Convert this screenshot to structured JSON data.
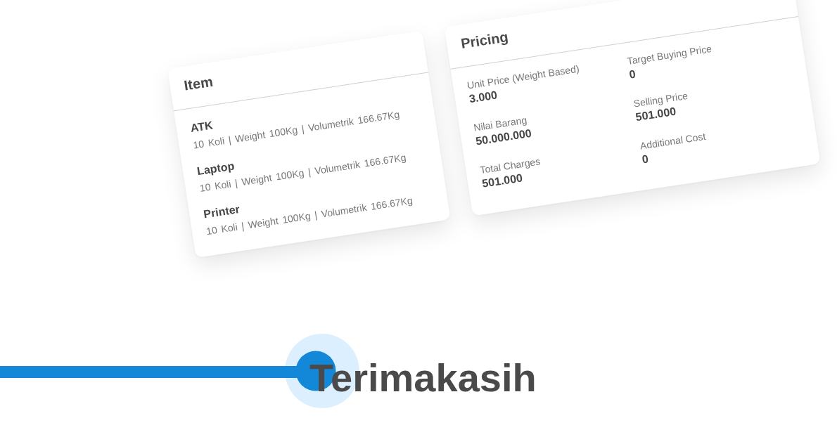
{
  "item_card": {
    "title": "Item",
    "items": [
      {
        "name": "ATK",
        "details": "10 Koli | Weight 100Kg | Volumetrik 166.67Kg"
      },
      {
        "name": "Laptop",
        "details": "10 Koli | Weight 100Kg | Volumetrik 166.67Kg"
      },
      {
        "name": "Printer",
        "details": "10 Koli | Weight 100Kg | Volumetrik 166.67Kg"
      }
    ]
  },
  "pricing_card": {
    "title": "Pricing",
    "fields": [
      {
        "label": "Unit Price (Weight Based)",
        "value": "3.000"
      },
      {
        "label": "Target Buying Price",
        "value": "0"
      },
      {
        "label": "Nilai Barang",
        "value": "50.000.000"
      },
      {
        "label": "Selling Price",
        "value": "501.000"
      },
      {
        "label": "Total Charges",
        "value": "501.000"
      },
      {
        "label": "Additional Cost",
        "value": "0"
      }
    ]
  },
  "closing": {
    "text": "Terimakasih"
  }
}
